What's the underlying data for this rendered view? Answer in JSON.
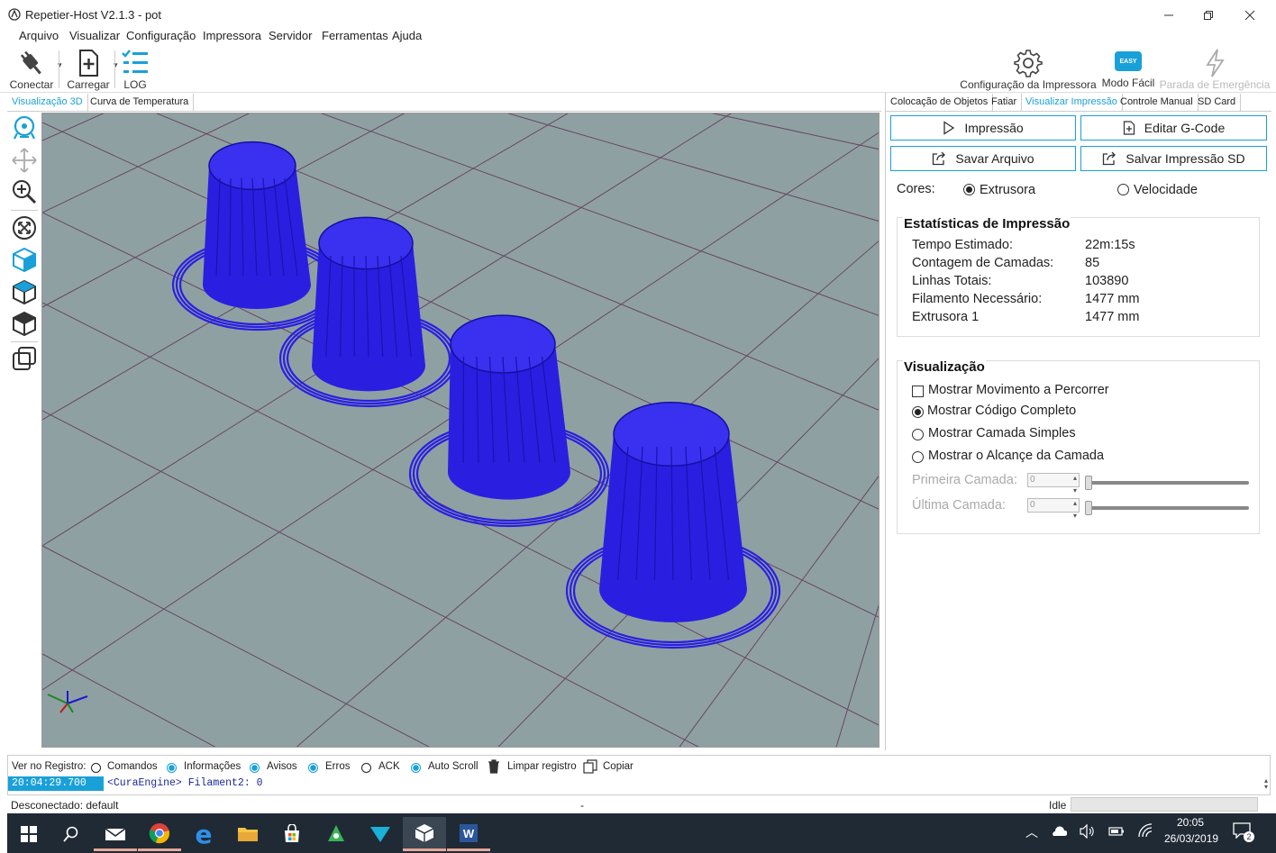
{
  "window": {
    "title": "Repetier-Host V2.1.3 - pot"
  },
  "menu": [
    "Arquivo",
    "Visualizar",
    "Configuração",
    "Impressora",
    "Servidor",
    "Ferramentas",
    "Ajuda"
  ],
  "toolbar": {
    "connect_label": "Conectar",
    "load_label": "Carregar",
    "log_label": "LOG",
    "printer_settings_label": "Configuração da Impressora",
    "easy_mode_label": "Modo Fácil",
    "easy_badge": "EASY",
    "emergency_label": "Parada de Emergência"
  },
  "left_tabs": [
    "Visualização 3D",
    "Curva de Temperatura"
  ],
  "right_tabs": [
    "Colocação de Objetos",
    "Fatiar",
    "Visualizar Impressão",
    "Controle Manual",
    "SD Card"
  ],
  "print_panel": {
    "print_button": "Impressão",
    "edit_gcode_button": "Editar G-Code",
    "save_file_button": "Savar Arquivo",
    "save_sd_button": "Salvar Impressão SD",
    "colors_label": "Cores:",
    "color_extruder": "Extrusora",
    "color_speed": "Velocidade",
    "stats_title": "Estatísticas de Impressão",
    "stats": [
      {
        "label": "Tempo Estimado:",
        "value": "22m:15s"
      },
      {
        "label": "Contagem de Camadas:",
        "value": "85"
      },
      {
        "label": "Linhas Totais:",
        "value": "103890"
      },
      {
        "label": "Filamento Necessário:",
        "value": "1477 mm"
      },
      {
        "label": "Extrusora 1",
        "value": "1477 mm"
      }
    ],
    "viz_title": "Visualização",
    "show_travel": "Mostrar Movimento a Percorrer",
    "show_full": "Mostrar Código Completo",
    "show_single": "Mostrar Camada Simples",
    "show_range": "Mostrar o Alcançe da Camada",
    "first_layer_label": "Primeira Camada:",
    "last_layer_label": "Última Camada:",
    "first_layer_value": "0",
    "last_layer_value": "0"
  },
  "log": {
    "filter_label": "Ver no Registro:",
    "commands": "Comandos",
    "info": "Informações",
    "warnings": "Avisos",
    "errors": "Erros",
    "ack": "ACK",
    "autoscroll": "Auto Scroll",
    "clear": "Limpar registro",
    "copy": "Copiar",
    "entry_time": "20:04:29.700",
    "entry_text": "<CuraEngine> Filament2: 0"
  },
  "status": {
    "connection": "Desconectado: default",
    "middle": "-",
    "state": "Idle"
  },
  "taskbar": {
    "time": "20:05",
    "date": "26/03/2019",
    "notifications": "2"
  },
  "colors": {
    "accent": "#1aa0d8",
    "model": "#2a1fe0",
    "viewport_bg": "#8fa0a3"
  }
}
